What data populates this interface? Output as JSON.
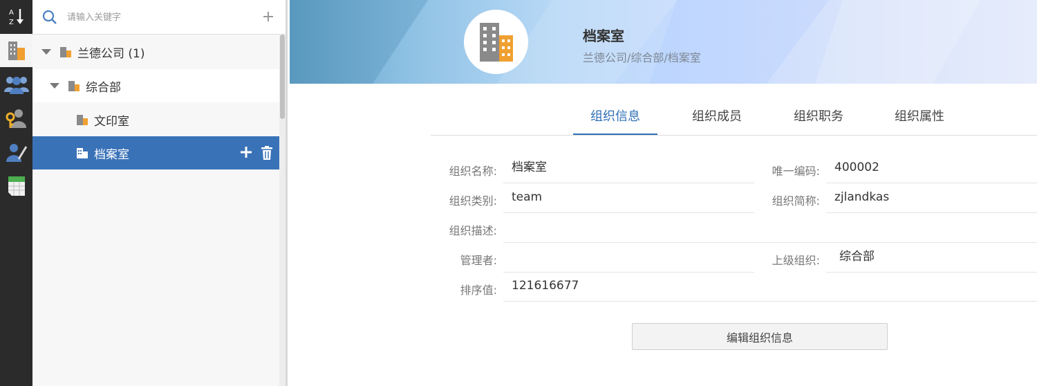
{
  "search": {
    "placeholder": "请输入关键字"
  },
  "tree": {
    "items": [
      {
        "label": "兰德公司 (1)",
        "level": 0,
        "expanded": true
      },
      {
        "label": "综合部",
        "level": 1,
        "expanded": true
      },
      {
        "label": "文印室",
        "level": 2
      },
      {
        "label": "档案室",
        "level": 2,
        "selected": true
      }
    ]
  },
  "rail": {
    "icons": [
      "sort-az-icon",
      "organization-icon",
      "users-group-icon",
      "user-key-icon",
      "user-edit-icon",
      "spreadsheet-icon"
    ]
  },
  "header": {
    "title": "档案室",
    "path": "兰德公司/综合部/档案室"
  },
  "tabs": [
    {
      "label": "组织信息",
      "active": true
    },
    {
      "label": "组织成员"
    },
    {
      "label": "组织职务"
    },
    {
      "label": "组织属性"
    }
  ],
  "form": {
    "name_label": "组织名称:",
    "name_value": "档案室",
    "code_label": "唯一编码:",
    "code_value": "400002",
    "category_label": "组织类别:",
    "category_value": "team",
    "short_label": "组织简称:",
    "short_value": "zjlandkas",
    "desc_label": "组织描述:",
    "desc_value": "",
    "manager_label": "管理者:",
    "manager_value": "",
    "parent_label": "上级组织:",
    "parent_value": "综合部",
    "order_label": "排序值:",
    "order_value": "121616677"
  },
  "actions": {
    "edit_label": "编辑组织信息"
  },
  "colors": {
    "accent": "#2f6fb5",
    "selected_row": "#3a72b8",
    "rail": "#2b2b2b",
    "building_orange": "#f0a030"
  }
}
